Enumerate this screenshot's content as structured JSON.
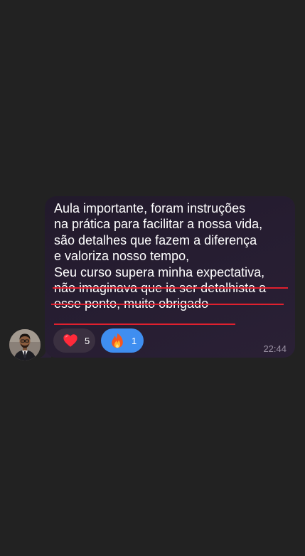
{
  "message": {
    "lines": [
      "Aula importante, foram instruções",
      "na prática para facilitar a nossa vida,",
      "são detalhes que fazem a diferença",
      "e valoriza nosso tempo,",
      "Seu curso supera minha expectativa,",
      "não imaginava que ia ser detalhista a",
      "esse ponto, muito obrigado"
    ],
    "time": "22:44",
    "underline_color": "#e0202e"
  },
  "reactions": [
    {
      "icon": "heart-icon",
      "count": "5"
    },
    {
      "icon": "fire-icon",
      "count": "1"
    }
  ],
  "colors": {
    "background": "#222222",
    "bubble": "#261d31",
    "reaction_selected": "#3f8ef0",
    "reaction_default": "#3a3040"
  }
}
